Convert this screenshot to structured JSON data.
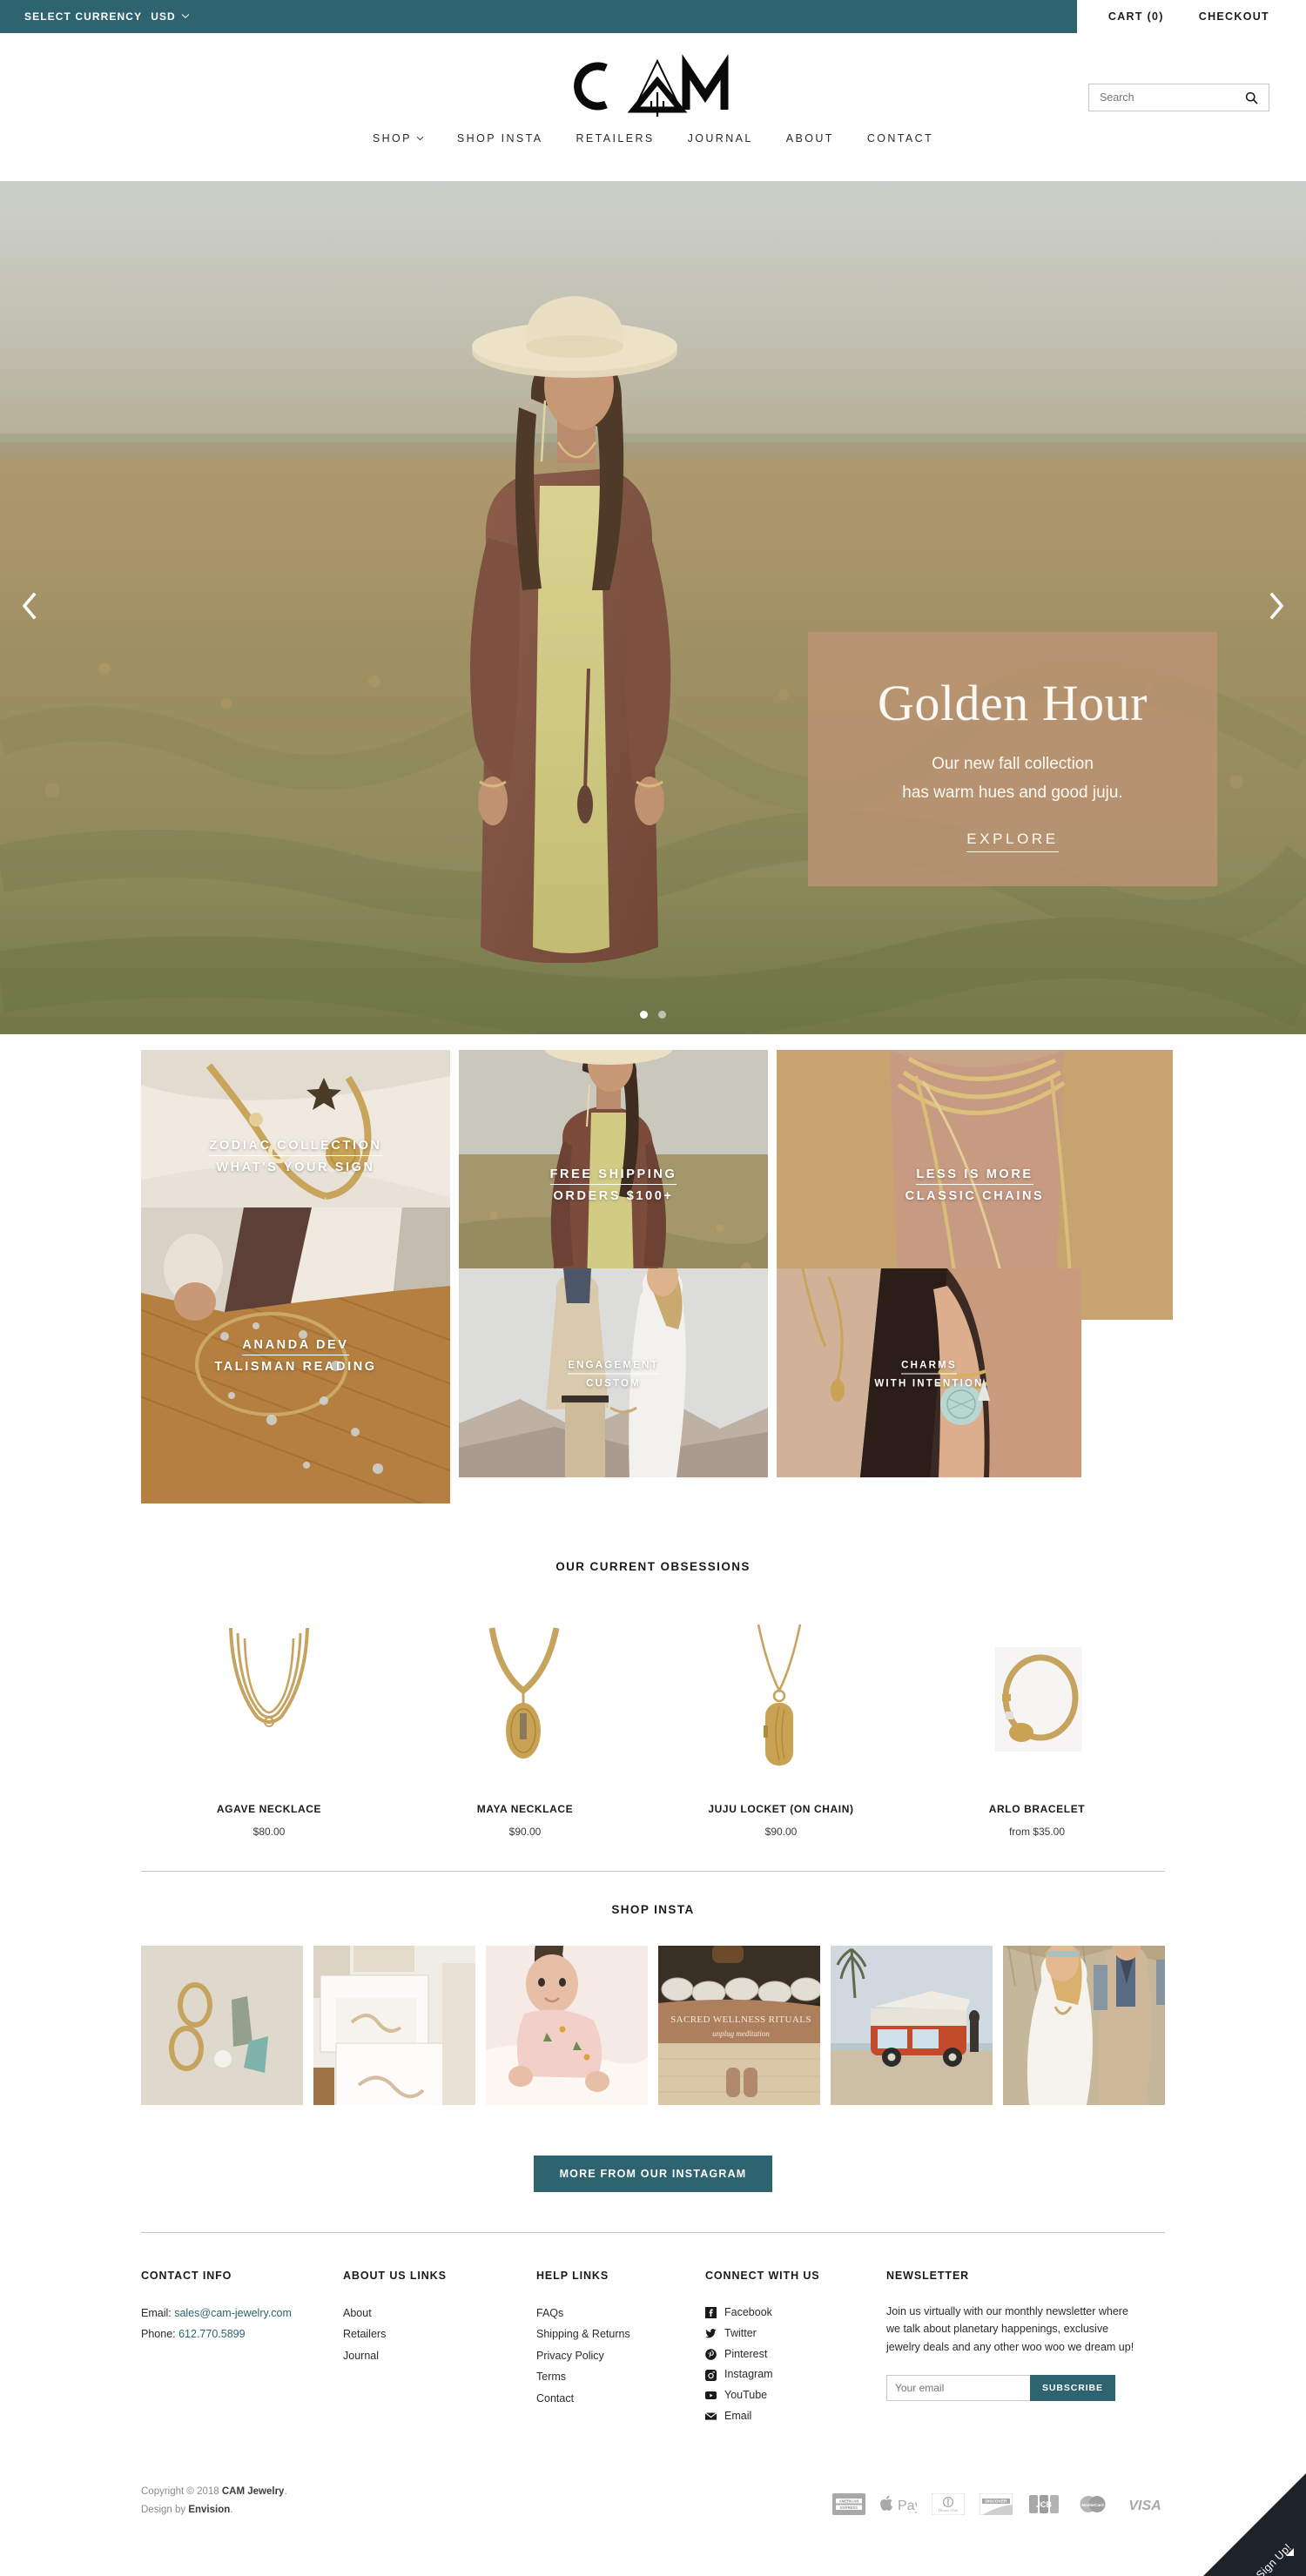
{
  "topbar": {
    "currency_label": "SELECT CURRENCY",
    "currency_value": "USD",
    "caret": "⌄",
    "cart": "CART (0)",
    "checkout": "CHECKOUT"
  },
  "header": {
    "logo_text": "CAM",
    "nav": [
      {
        "label": "SHOP",
        "has_caret": true
      },
      {
        "label": "SHOP INSTA",
        "has_caret": false
      },
      {
        "label": "RETAILERS",
        "has_caret": false
      },
      {
        "label": "JOURNAL",
        "has_caret": false
      },
      {
        "label": "ABOUT",
        "has_caret": false
      },
      {
        "label": "CONTACT",
        "has_caret": false
      }
    ],
    "search_placeholder": "Search",
    "search_value": ""
  },
  "hero": {
    "title": "Golden Hour",
    "line1": "Our new fall collection",
    "line2": "has warm hues and good juju.",
    "cta": "EXPLORE",
    "prev_icon": "chevron-left-icon",
    "next_icon": "chevron-right-icon",
    "slide_count": 2,
    "active_slide": 1,
    "panel_color": "#be9374"
  },
  "tiles": [
    {
      "line1": "ZODIAC COLLECTION",
      "line2": "WHAT'S YOUR SIGN"
    },
    {
      "line1": "FREE SHIPPING",
      "line2": "ORDERS $100+"
    },
    {
      "line1": "LESS IS MORE",
      "line2": "CLASSIC CHAINS"
    },
    {
      "line1": "ANANDA DEV",
      "line2": "TALISMAN READING"
    },
    {
      "line1": "ENGAGEMENT",
      "line2": "CUSTOM"
    },
    {
      "line1": "CHARMS",
      "line2": "WITH INTENTION"
    }
  ],
  "products_section": {
    "title": "OUR CURRENT OBSESSIONS",
    "items": [
      {
        "name": "AGAVE NECKLACE",
        "price": "$80.00"
      },
      {
        "name": "MAYA NECKLACE",
        "price": "$90.00"
      },
      {
        "name": "JUJU LOCKET (ON CHAIN)",
        "price": "$90.00"
      },
      {
        "name": "ARLO BRACELET",
        "price": "from $35.00"
      }
    ]
  },
  "insta_section": {
    "title": "SHOP INSTA",
    "button": "MORE FROM OUR INSTAGRAM",
    "cells": [
      {
        "alt": "gold-hoop-earrings-and-stones"
      },
      {
        "alt": "framed-art-prints-leaning"
      },
      {
        "alt": "baby-in-pink-outfit"
      },
      {
        "alt": "sacred-wellness-rituals-unplug-meditation"
      },
      {
        "alt": "orange-vw-bus-at-beach"
      },
      {
        "alt": "couple-at-outdoor-wedding"
      }
    ],
    "overlay_caption": {
      "line1": "SACRED WELLNESS RITUALS",
      "line2": "unplug meditation"
    }
  },
  "footer": {
    "contact": {
      "title": "CONTACT INFO",
      "email_label": "Email: ",
      "email": "sales@cam-jewelry.com",
      "phone_label": "Phone: ",
      "phone": "612.770.5899"
    },
    "about": {
      "title": "ABOUT US LINKS",
      "links": [
        "About",
        "Retailers",
        "Journal"
      ]
    },
    "help": {
      "title": "HELP LINKS",
      "links": [
        "FAQs",
        "Shipping & Returns",
        "Privacy Policy",
        "Terms",
        "Contact"
      ]
    },
    "connect": {
      "title": "CONNECT WITH US",
      "links": [
        {
          "label": "Facebook",
          "icon": "facebook-icon"
        },
        {
          "label": "Twitter",
          "icon": "twitter-icon"
        },
        {
          "label": "Pinterest",
          "icon": "pinterest-icon"
        },
        {
          "label": "Instagram",
          "icon": "instagram-icon"
        },
        {
          "label": "YouTube",
          "icon": "youtube-icon"
        },
        {
          "label": "Email",
          "icon": "email-icon"
        }
      ]
    },
    "newsletter": {
      "title": "NEWSLETTER",
      "body": "Join us virtually with our monthly newsletter where we talk about planetary happenings, exclusive jewelry deals and any other woo woo we dream up!",
      "placeholder": "Your email",
      "value": "",
      "button": "SUBSCRIBE"
    }
  },
  "bottom": {
    "copyright_prefix": "Copyright © 2018 ",
    "copyright_brand": "CAM Jewelry",
    "copyright_suffix": ".",
    "design_prefix": "Design by ",
    "design_brand": "Envision",
    "design_suffix": ".",
    "payments": [
      "AMERICAN EXPRESS",
      "Apple Pay",
      "Diners Club",
      "DISCOVER",
      "JCB",
      "MasterCard",
      "VISA"
    ],
    "signup_ribbon": "Sign Up!"
  },
  "colors": {
    "teal": "#2d6470",
    "hero_panel": "#be9374",
    "dark": "#1e222b",
    "link_teal": "#2d6470"
  }
}
